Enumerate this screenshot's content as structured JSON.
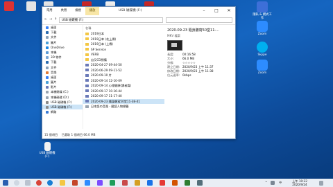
{
  "window": {
    "tabs": [
      "常用",
      "共用",
      "檢視"
    ],
    "contextual_tab": "播放",
    "title": "USB 磁碟機 (F:)"
  },
  "address": "USB 磁碟機 (F:)",
  "nav": [
    {
      "label": "桌面",
      "icon": "desktop-icon"
    },
    {
      "label": "下載",
      "icon": "download-icon"
    },
    {
      "label": "文件",
      "icon": "document-icon"
    },
    {
      "label": "圖片",
      "icon": "picture-icon"
    },
    {
      "label": "OneDrive",
      "icon": "cloud-icon"
    },
    {
      "label": "本機",
      "icon": "computer-icon"
    },
    {
      "label": "3D 物件",
      "icon": "cube-icon"
    },
    {
      "label": "下載",
      "icon": "download-icon"
    },
    {
      "label": "文件",
      "icon": "document-icon"
    },
    {
      "label": "音樂",
      "icon": "music-icon"
    },
    {
      "label": "桌面",
      "icon": "desktop-icon"
    },
    {
      "label": "圖片",
      "icon": "picture-icon"
    },
    {
      "label": "影片",
      "icon": "video-icon"
    },
    {
      "label": "本機磁碟 (C:)",
      "icon": "drive-icon"
    },
    {
      "label": "本機磁碟 (D:)",
      "icon": "drive-icon"
    },
    {
      "label": "USB 磁碟機 (F:)",
      "icon": "usb-drive-icon"
    },
    {
      "label": "USB 磁碟機 (F:)",
      "icon": "usb-drive-icon"
    },
    {
      "label": "網路",
      "icon": "network-icon"
    }
  ],
  "list": {
    "column_header": "名稱",
    "files": [
      {
        "name": "2019日本",
        "type": "folder"
      },
      {
        "name": "2019日本 (花上傳)",
        "type": "folder"
      },
      {
        "name": "2019日本 (上傳)",
        "type": "folder"
      },
      {
        "name": "SP Service",
        "type": "folder"
      },
      {
        "name": "VERB",
        "type": "folder"
      },
      {
        "name": "自又CD預備",
        "type": "folder"
      },
      {
        "name": "2020-04-27 09-44-50",
        "type": "video"
      },
      {
        "name": "2020-06-29 09-11-52",
        "type": "video"
      },
      {
        "name": "2020-09-10 片",
        "type": "video"
      },
      {
        "name": "2020-09-14 12-10-09",
        "type": "video"
      },
      {
        "name": "2020-09-14 心理健康(讀者篇)",
        "type": "video"
      },
      {
        "name": "2020-09-17 10-16-44",
        "type": "video"
      },
      {
        "name": "2020-09-17 11-17-40",
        "type": "video"
      },
      {
        "name": "2020-09-23 隨身聽寫50堂11-38-41",
        "type": "video",
        "selected": true
      },
      {
        "name": "日本語の音楽 - 國語人物標籤",
        "type": "file"
      }
    ]
  },
  "details": {
    "name": "2020-09-23 隨身聽寫50堂11-...",
    "type": "MKV 檔案",
    "props": [
      {
        "k": "長度:",
        "v": "00:16:58"
      },
      {
        "k": "大小:",
        "v": "66.0 MB"
      },
      {
        "k": "分級:",
        "v": "☆☆☆☆☆"
      },
      {
        "k": "建立日期:",
        "v": "2020/9/23 上午 11:37"
      },
      {
        "k": "修改日期:",
        "v": "2020/9/23 上午 11:38"
      },
      {
        "k": "位元速率:",
        "v": "0kbps"
      }
    ]
  },
  "status": {
    "count": "15 個項目",
    "selected": "已選取 1 個項目 66.0 MB"
  },
  "desktop_icons": [
    {
      "label": "隱私 & 模式工作",
      "icon": "paint-icon"
    },
    {
      "label": "Zoom",
      "icon": "zoom-icon"
    },
    {
      "label": "Skype",
      "icon": "skype-icon"
    },
    {
      "label": "Zoom",
      "icon": "zoom-icon"
    }
  ],
  "usb_icon_label": "USB 磁碟機 (F:)",
  "clock": {
    "time": "上午 10:22",
    "date": "2020/9/24"
  },
  "tray": {
    "lang": "中",
    "caret": "^"
  },
  "colors": {
    "accent": "#cce4f7",
    "folder": "#f3c744",
    "desktop": "#1565c0"
  }
}
